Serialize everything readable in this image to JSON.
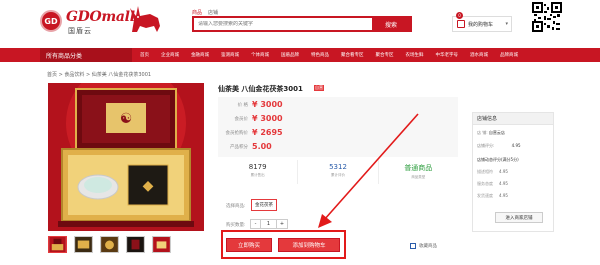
{
  "header": {
    "logo_mark": "GD",
    "logo_text": "GDOmall",
    "logo_sub": "国盾云",
    "search": {
      "tabs": [
        "商品",
        "店铺"
      ],
      "placeholder": "请输入您要搜索的关键字",
      "button": "搜索"
    },
    "cart": {
      "count": "0",
      "label": "我的购物车",
      "caret": "▾"
    }
  },
  "nav": {
    "all_label": "所有商品分类",
    "items": [
      "首页",
      "企业商城",
      "金融商城",
      "鉴测商城",
      "个体商城",
      "国盾品牌",
      "特色商品",
      "聚合看专区",
      "聚合专区",
      "农场生鲜",
      "中华老字号",
      "酒水商城",
      "品牌商城"
    ]
  },
  "breadcrumb": "首页 > 食品饮料 > 仙茶美 八仙金花茯茶3001",
  "product": {
    "title": "仙茶美 八仙金花茯茶3001",
    "badge": "自营",
    "prices": [
      {
        "label": "价    格",
        "value": "¥ 3000"
      },
      {
        "label": "会员价",
        "value": "¥ 3000"
      },
      {
        "label": "会员抢购价",
        "value": "¥ 2695"
      },
      {
        "label": "产品积分",
        "value": "5.00"
      }
    ],
    "stats": [
      {
        "num": "8179",
        "label": "累计售出"
      },
      {
        "num": "5312",
        "label": "累计评价"
      },
      {
        "num": "普通商品",
        "label": "商品类型"
      }
    ],
    "select_label": "选择商品:",
    "select_option": "金花茯茶",
    "qty_label": "购买数量:",
    "qty_value": "1",
    "qty_minus": "-",
    "qty_plus": "+",
    "buy_now": "立即购买",
    "add_cart": "添加到购物车",
    "favorite": "收藏商品"
  },
  "store": {
    "title": "店铺信息",
    "name_label": "店    铺:",
    "name": "自营云店",
    "rating_label": "店铺评分:",
    "rating": "4.95",
    "dynamic_label": "店铺动态评分(满分5分)",
    "scores": [
      {
        "label": "描述相符",
        "value": "4.95"
      },
      {
        "label": "服务态度",
        "value": "4.95"
      },
      {
        "label": "发货速度",
        "value": "4.95"
      }
    ],
    "visit_button": "进入商家店铺"
  },
  "colors": {
    "brand_red": "#c81623",
    "price_red": "#e4393c",
    "highlight": "#e21a1a"
  }
}
